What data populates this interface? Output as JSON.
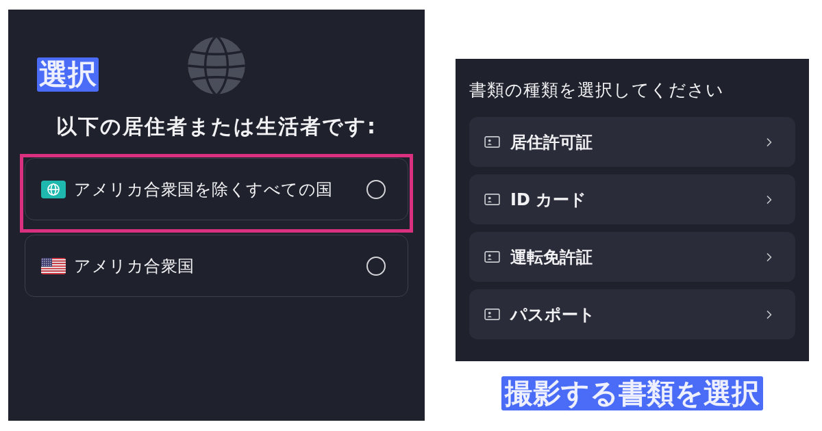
{
  "annotations": {
    "label": "選択",
    "caption": "撮影する書類を選択"
  },
  "residence_screen": {
    "heading": "以下の居住者または生活者です:",
    "options": [
      {
        "kind": "globe",
        "label": "アメリカ合衆国を除くすべての国",
        "selected": false,
        "highlighted": true
      },
      {
        "kind": "flag",
        "label": "アメリカ合衆国",
        "selected": false,
        "highlighted": false
      }
    ]
  },
  "document_screen": {
    "title": "書類の種類を選択してください",
    "documents": [
      {
        "label": "居住許可証"
      },
      {
        "label": "ID カード"
      },
      {
        "label": "運転免許証"
      },
      {
        "label": "パスポート"
      }
    ]
  }
}
